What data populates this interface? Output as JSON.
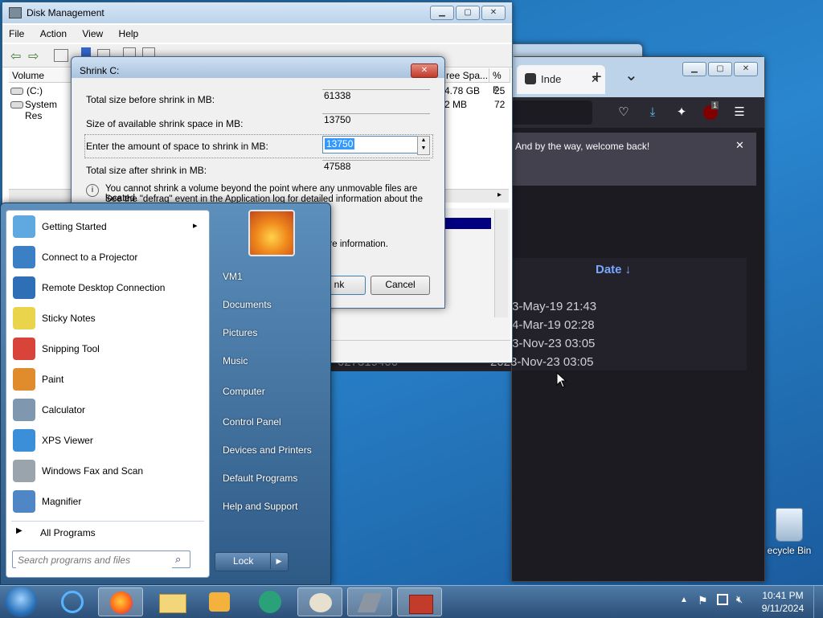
{
  "desktop": {
    "recycle_bin_label": "ecycle Bin"
  },
  "browser": {
    "tab_title": "Inde",
    "tab_close": "✕",
    "new_tab": "+",
    "tab_list": "⌄",
    "notice_text": "And by the way, welcome back!",
    "notice_close": "✕",
    "ublock_badge": "1",
    "date_header": "Date ↓",
    "rows": [
      {
        "left": "",
        "date": "3-May-19 21:43"
      },
      {
        "left": "",
        "date": "4-Mar-19 02:28"
      },
      {
        "left": "",
        "date": "3-Nov-23 03:05"
      },
      {
        "left": "027319400",
        "date": "2023-Nov-23 03:05"
      }
    ]
  },
  "disk_management": {
    "title": "Disk Management",
    "menu": [
      "File",
      "Action",
      "View",
      "Help"
    ],
    "columns": {
      "volume": "Volume",
      "free_space": "ree Spa...",
      "percent": "% F"
    },
    "volumes": [
      {
        "name": "(C:)",
        "free": "4.78 GB",
        "pct": "25"
      },
      {
        "name": "System Res",
        "free": "2 MB",
        "pct": "72"
      }
    ]
  },
  "shrink_dialog": {
    "title": "Shrink C:",
    "labels": {
      "total_before": "Total size before shrink in MB:",
      "available": "Size of available shrink space in MB:",
      "enter_amount": "Enter the amount of space to shrink in MB:",
      "total_after": "Total size after shrink in MB:"
    },
    "values": {
      "total_before": "61338",
      "available": "13750",
      "enter_amount": "13750",
      "total_after": "47588"
    },
    "info_line1": "You cannot shrink a volume beyond the point where any unmovable files are located.",
    "info_line2": "See the \"defrag\" event in the Application log for detailed information about the",
    "info_more": "ore information.",
    "shrink_button": "nk",
    "cancel_button": "Cancel"
  },
  "start_menu": {
    "programs": [
      {
        "label": "Getting Started",
        "color": "#5fa8e0",
        "arrow": "▸"
      },
      {
        "label": "Connect to a Projector",
        "color": "#3b7fc4"
      },
      {
        "label": "Remote Desktop Connection",
        "color": "#2f6fb5"
      },
      {
        "label": "Sticky Notes",
        "color": "#e9d44b"
      },
      {
        "label": "Snipping Tool",
        "color": "#d9443a"
      },
      {
        "label": "Paint",
        "color": "#e08b2c"
      },
      {
        "label": "Calculator",
        "color": "#7f98b0"
      },
      {
        "label": "XPS Viewer",
        "color": "#3a8fd8"
      },
      {
        "label": "Windows Fax and Scan",
        "color": "#9aa4ad"
      },
      {
        "label": "Magnifier",
        "color": "#4f86c6"
      }
    ],
    "all_programs": "All Programs",
    "search_placeholder": "Search programs and files",
    "right": [
      "VM1",
      "Documents",
      "Pictures",
      "Music",
      "Computer",
      "Control Panel",
      "Devices and Printers",
      "Default Programs",
      "Help and Support"
    ],
    "lock_label": "Lock"
  },
  "taskbar": {
    "time": "10:41 PM",
    "date": "9/11/2024"
  }
}
